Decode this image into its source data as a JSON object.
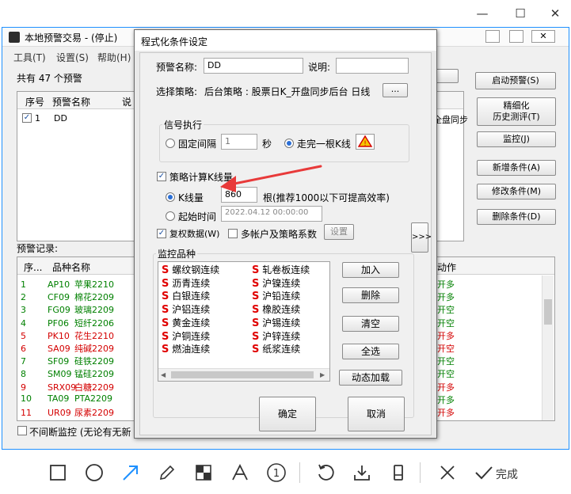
{
  "window_controls": {
    "minimize": "—",
    "maximize": "☐",
    "close": "✕"
  },
  "main": {
    "title": "本地预警交易 - (停止)",
    "menu": [
      "工具(T)",
      "设置(S)",
      "帮助(H)"
    ],
    "count_text": "共有 47 个预警",
    "table_headers": {
      "seq": "序号",
      "name": "预警名称",
      "desc": "说"
    },
    "row1": {
      "seq": "1",
      "name": "DD",
      "right": "全盘同步"
    },
    "right_buttons": {
      "start": "启动预警(S)",
      "refine_line1": "精细化",
      "refine_line2": "历史测评(T)",
      "monitor": "监控(J)",
      "add": "新增条件(A)",
      "edit": "修改条件(M)",
      "delete": "删除条件(D)"
    },
    "records_label": "预警记录:",
    "records_headers": {
      "seq": "序...",
      "name": "品种名称",
      "action": "动作"
    },
    "records": [
      {
        "seq": "1",
        "code": "AP10",
        "name": "苹果2210",
        "action": "开多",
        "color": "#008000"
      },
      {
        "seq": "2",
        "code": "CF09",
        "name": "棉花2209",
        "action": "开多",
        "color": "#008000"
      },
      {
        "seq": "3",
        "code": "FG09",
        "name": "玻璃2209",
        "action": "开空",
        "color": "#008000"
      },
      {
        "seq": "4",
        "code": "PF06",
        "name": "短纤2206",
        "action": "开空",
        "color": "#008000"
      },
      {
        "seq": "5",
        "code": "PK10",
        "name": "花生2210",
        "action": "开多",
        "color": "#d40000"
      },
      {
        "seq": "6",
        "code": "SA09",
        "name": "纯碱2209",
        "action": "开空",
        "color": "#d40000"
      },
      {
        "seq": "7",
        "code": "SF09",
        "name": "硅铁2209",
        "action": "开空",
        "color": "#008000"
      },
      {
        "seq": "8",
        "code": "SM09",
        "name": "锰硅2209",
        "action": "开空",
        "color": "#008000"
      },
      {
        "seq": "9",
        "code": "SRX09",
        "name": "白糖2209",
        "action": "开多",
        "color": "#d40000"
      },
      {
        "seq": "10",
        "code": "TA09",
        "name": "PTA2209",
        "action": "开多",
        "color": "#008000"
      },
      {
        "seq": "11",
        "code": "UR09",
        "name": "尿素2209",
        "action": "开多",
        "color": "#d40000"
      }
    ],
    "continuous_label": "不间断监控 (无论有无新"
  },
  "dialog": {
    "title": "程式化条件设定",
    "name_label": "预警名称:",
    "name_value": "DD",
    "desc_label": "说明:",
    "desc_value": "",
    "strategy_label": "选择策略:",
    "strategy_value": "后台策略 : 股票日K_开盘同步后台 日线",
    "browse_label": "...",
    "signal_group": "信号执行",
    "fixed_interval_label": "固定间隔",
    "interval_value": "1",
    "seconds_label": "秒",
    "after_bar_label": "走完一根K线",
    "calc_k_label": "策略计算K线量",
    "k_count_label": "K线量",
    "k_count_value": "860",
    "k_hint": "根(推荐1000以下可提高效率)",
    "start_time_label": "起始时间",
    "start_time_value": "2022.04.12 00:00:00",
    "expand_label": ">>>",
    "adjust_label": "复权数据(W)",
    "multi_acct_label": "多帐户及策略系数",
    "settings_label": "设置",
    "monitor_group": "监控品种",
    "varieties_col1": [
      "螺纹钢连续",
      "沥青连续",
      "白银连续",
      "沪铝连续",
      "黄金连续",
      "沪铜连续",
      "燃油连续"
    ],
    "varieties_col2": [
      "轧卷板连续",
      "沪镍连续",
      "沪铅连续",
      "橡胶连续",
      "沪锡连续",
      "沪锌连续",
      "纸浆连续"
    ],
    "variety_symbol": "S",
    "buttons": {
      "add": "加入",
      "delete": "删除",
      "clear": "清空",
      "select_all": "全选",
      "dynamic": "动态加载"
    },
    "ok_label": "确定",
    "cancel_label": "取消"
  },
  "toolbar": {
    "done_label": "完成"
  },
  "accent_color": "#1e90ff"
}
